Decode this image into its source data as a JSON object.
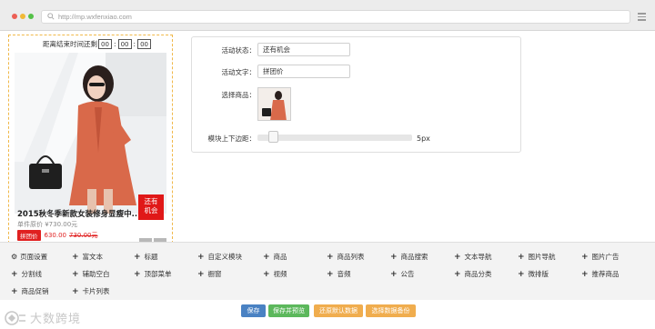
{
  "browser": {
    "url": "http://mp.wxfenxiao.com"
  },
  "preview": {
    "countdown_label": "距离结束时间还剩",
    "countdown": [
      "00",
      "00",
      "00"
    ],
    "product_title": "2015秋冬季新款女装修身显瘦中...",
    "original_price_text": "单件原价 ¥730.00元",
    "group_badge": "拼团价",
    "group_price": "630.00",
    "strike_price": "730.00元",
    "chance_tag_line1": "还有",
    "chance_tag_line2": "机会"
  },
  "settings": {
    "status_label": "活动状态：",
    "status_value": "还有机会",
    "text_label": "活动文字：",
    "text_value": "拼团价",
    "product_label": "选择商品：",
    "margin_label": "模块上下边距：",
    "margin_value_text": "5px",
    "margin_value": 5
  },
  "modules": {
    "row1": [
      "页面设置",
      "富文本",
      "标题",
      "自定义模块",
      "商品",
      "商品列表",
      "商品搜索",
      "文本导航",
      "图片导航",
      "图片广告"
    ],
    "row2": [
      "分割线",
      "辅助空白",
      "顶部菜单",
      "橱窗",
      "视频",
      "音频",
      "公告",
      "商品分类",
      "微排版",
      "推荐商品"
    ],
    "row3": [
      "商品促销",
      "卡片列表"
    ]
  },
  "buttons": {
    "save": "保存",
    "save_preview": "保存并预览",
    "restore_default": "还原默认数据",
    "select_backup": "选择数据备份"
  },
  "colors": {
    "accent_red": "#e02020",
    "button_blue": "#4a82c3",
    "button_green": "#5cb85c",
    "button_orange": "#f0ad4e",
    "preview_border": "#f0b849"
  },
  "icons": {
    "search": "search-icon",
    "menu": "hamburger-menu-icon",
    "page_settings": "gear-icon",
    "add": "plus-icon"
  },
  "watermark": {
    "text": "大数跨境"
  }
}
